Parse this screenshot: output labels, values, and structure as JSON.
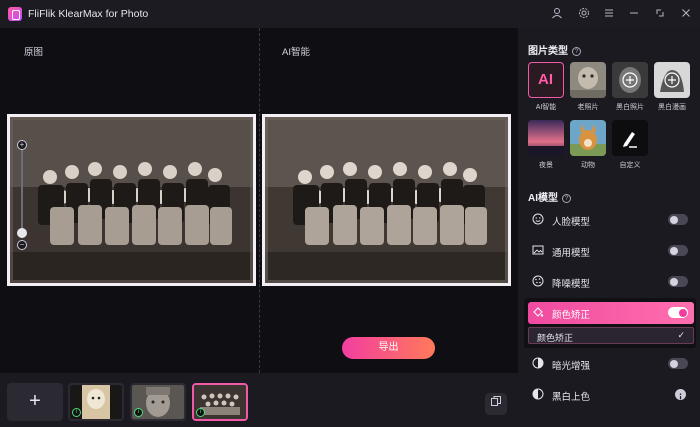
{
  "titlebar": {
    "title": "FliFlik KlearMax for Photo"
  },
  "stage": {
    "left_label": "原图",
    "right_label": "AI智能",
    "export_label": "导出"
  },
  "filmstrip": {
    "add_label": "+"
  },
  "sidebar": {
    "photo_type_title": "图片类型",
    "ai_tile_text": "AI",
    "photo_types": [
      "AI智能",
      "老照片",
      "黑白照片",
      "黑白漫画",
      "夜景",
      "动物",
      "自定义"
    ],
    "model_title": "AI模型",
    "models": [
      {
        "name": "人脸模型",
        "enabled": false
      },
      {
        "name": "通用模型",
        "enabled": false
      },
      {
        "name": "降噪模型",
        "enabled": false
      },
      {
        "name": "颜色矫正",
        "enabled": true
      },
      {
        "name": "暗光增强",
        "enabled": false
      },
      {
        "name": "黑白上色",
        "enabled": false
      }
    ],
    "color_dropdown_value": "颜色矫正"
  },
  "colors": {
    "accent": "#f23ea0",
    "accent2": "#ff7a59",
    "bg": "#15141b"
  }
}
